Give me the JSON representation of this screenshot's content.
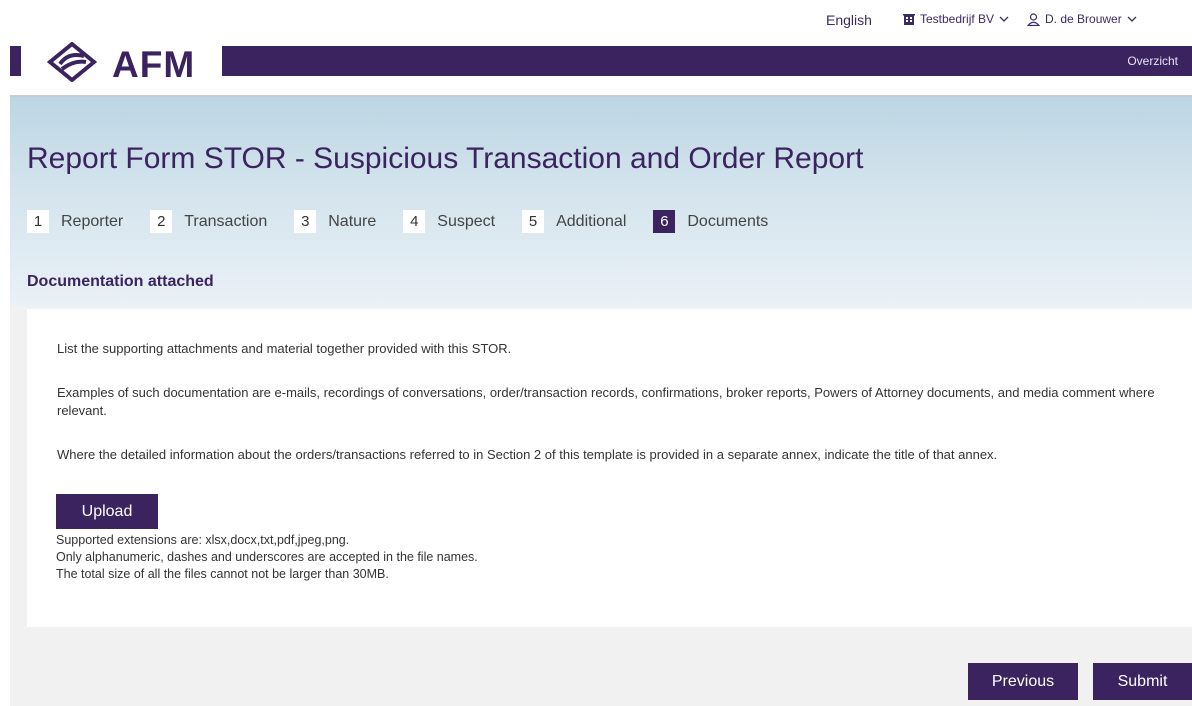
{
  "utility": {
    "language": "English",
    "company": "Testbedrijf BV",
    "user": "D. de Brouwer"
  },
  "brand": {
    "logo_text": "AFM",
    "overview_link": "Overzicht",
    "primary_color": "#3b2360"
  },
  "page": {
    "title": "Report Form STOR - Suspicious Transaction and Order Report",
    "section_title": "Documentation attached"
  },
  "steps": [
    {
      "num": "1",
      "label": "Reporter"
    },
    {
      "num": "2",
      "label": "Transaction"
    },
    {
      "num": "3",
      "label": "Nature"
    },
    {
      "num": "4",
      "label": "Suspect"
    },
    {
      "num": "5",
      "label": "Additional"
    },
    {
      "num": "6",
      "label": "Documents",
      "active": true
    }
  ],
  "content": {
    "p1": "List the supporting attachments and material together provided with this STOR.",
    "p2": "Examples of such documentation are e-mails, recordings of conversations, order/transaction records, confirmations, broker reports, Powers of Attorney documents, and media comment where relevant.",
    "p3": "Where the detailed information about the orders/transactions referred to in Section 2 of this template is provided in a separate annex, indicate the title of that annex.",
    "upload_label": "Upload",
    "info1": "Supported extensions are: xlsx,docx,txt,pdf,jpeg,png.",
    "info2": "Only alphanumeric, dashes and underscores are accepted in the file names.",
    "info3": "The total size of all the files cannot not be larger than 30MB."
  },
  "actions": {
    "previous": "Previous",
    "submit": "Submit"
  }
}
